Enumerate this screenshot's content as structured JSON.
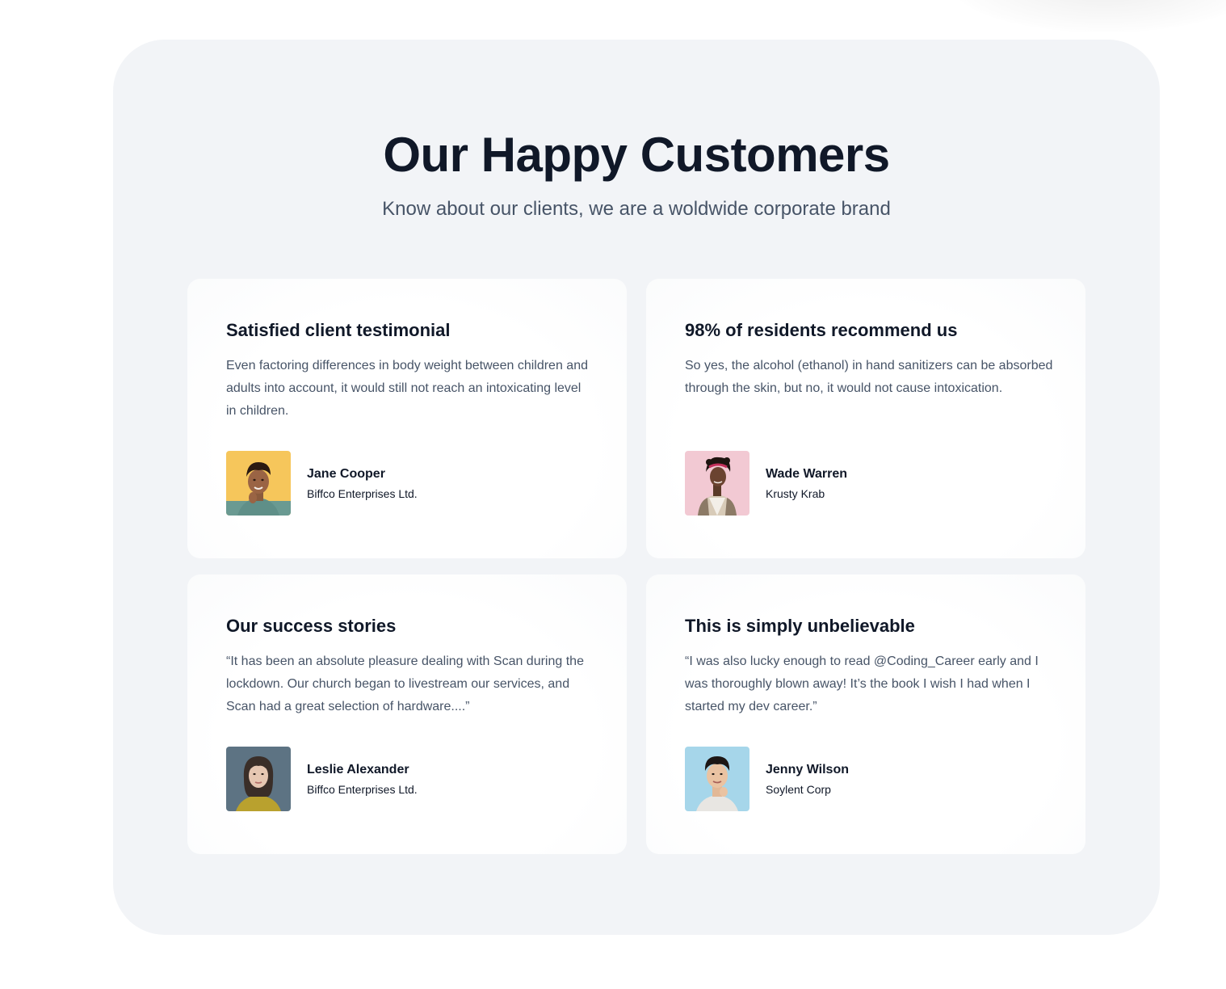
{
  "header": {
    "title": "Our Happy Customers",
    "subtitle": "Know about our clients, we are a woldwide corporate brand"
  },
  "testimonials": [
    {
      "title": "Satisfied client testimonial",
      "body": "Even factoring differences in body weight between children and adults into account, it would still not reach an intoxicating level in children.",
      "name": "Jane Cooper",
      "company": "Biffco Enterprises Ltd.",
      "avatar_icon": "person-photo-icon",
      "avatar_bg": "#f6c65b"
    },
    {
      "title": "98% of residents recommend us",
      "body": "So yes, the alcohol (ethanol) in hand sanitizers can be absorbed through the skin, but no, it would not cause intoxication.",
      "name": "Wade Warren",
      "company": "Krusty Krab",
      "avatar_icon": "person-photo-icon",
      "avatar_bg": "#f2c9d3"
    },
    {
      "title": "Our success stories",
      "body": "“It has been an absolute pleasure dealing with Scan during the lockdown. Our church began to livestream our services, and Scan had a great selection of hardware....”",
      "name": "Leslie Alexander",
      "company": "Biffco Enterprises Ltd.",
      "avatar_icon": "person-photo-icon",
      "avatar_bg": "#5d7383"
    },
    {
      "title": "This is simply unbelievable",
      "body": "“I was also lucky enough to read @Coding_Career early and I was thoroughly blown away! It’s the book I wish I had when I started my dev career.”",
      "name": "Jenny Wilson",
      "company": "Soylent Corp",
      "avatar_icon": "person-photo-icon",
      "avatar_bg": "#a6d6ea"
    }
  ],
  "colors": {
    "section_bg": "#f2f4f7",
    "heading": "#101828",
    "body_text": "#475467"
  }
}
